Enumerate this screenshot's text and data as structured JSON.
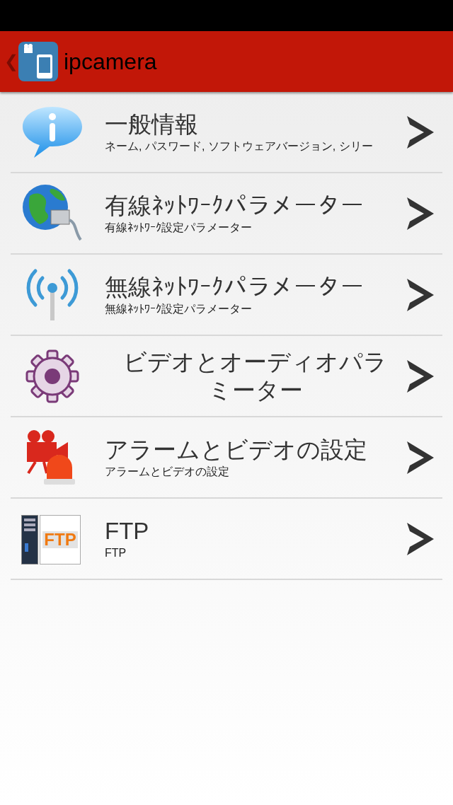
{
  "header": {
    "back": "❮",
    "title": "ipcamera"
  },
  "rows": [
    {
      "kind": "info",
      "title": "一般情報",
      "subtitle": "ネーム, パスワード, ソフトウェアバージョン, シリー"
    },
    {
      "kind": "globe",
      "title": "有線ﾈｯﾄﾜｰｸパラメーター",
      "subtitle": "有線ﾈｯﾄﾜｰｸ設定パラメーター"
    },
    {
      "kind": "wifi",
      "title": "無線ﾈｯﾄﾜｰｸパラメーター",
      "subtitle": "無線ﾈｯﾄﾜｰｸ設定パラメーター"
    },
    {
      "kind": "gear",
      "title": "ビデオとオーディオパラミーター"
    },
    {
      "kind": "alarm",
      "title": "アラームとビデオの設定",
      "subtitle": "アラームとビデオの設定"
    },
    {
      "kind": "ftp",
      "title": "FTP",
      "subtitle": "FTP",
      "icon_text": "FTP"
    }
  ]
}
